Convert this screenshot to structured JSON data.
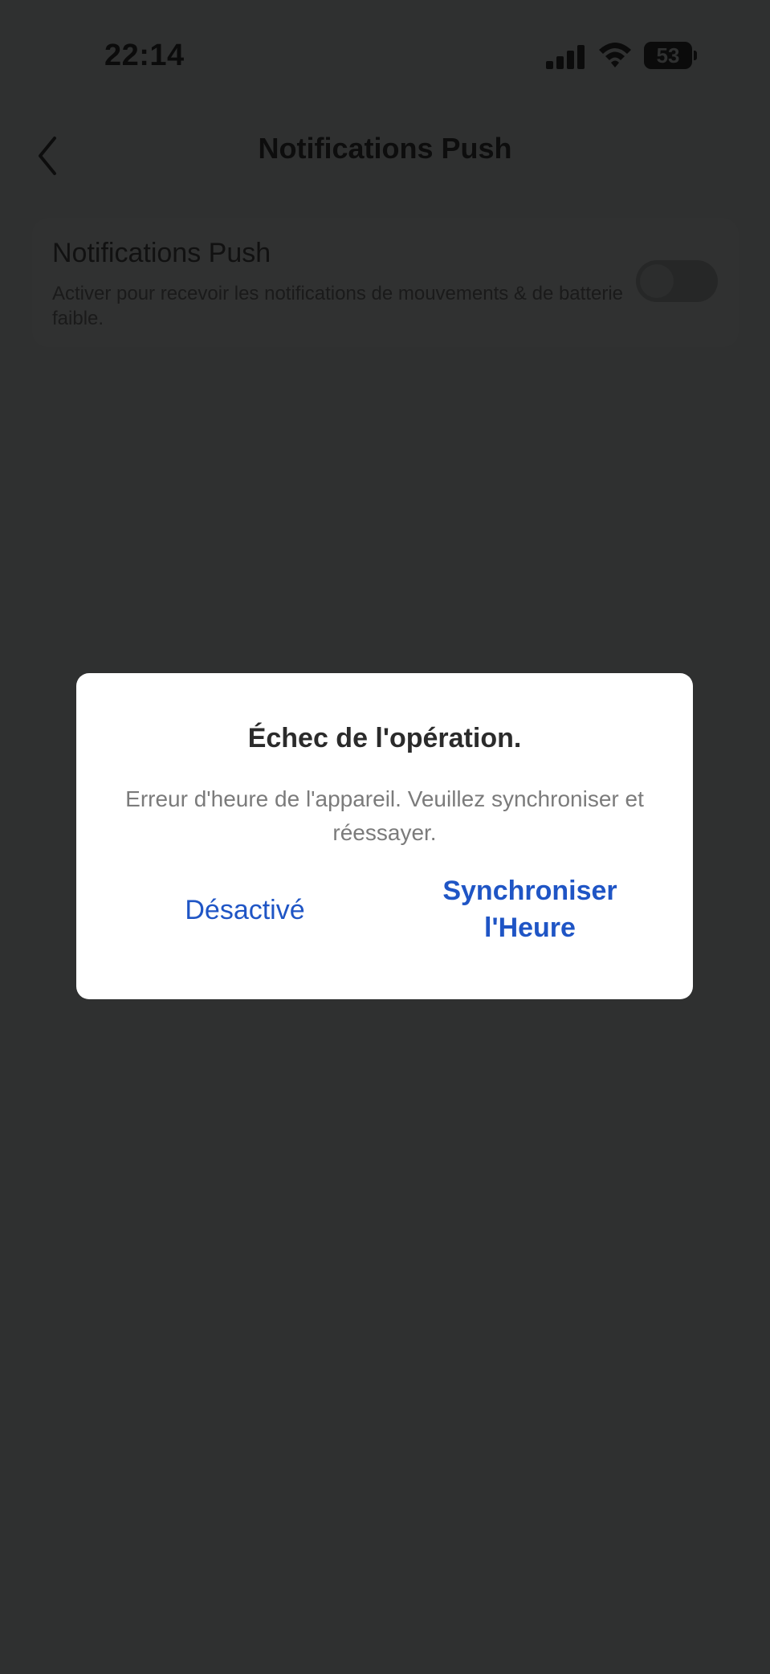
{
  "status_bar": {
    "time": "22:14",
    "battery": "53"
  },
  "header": {
    "title": "Notifications Push"
  },
  "setting": {
    "title": "Notifications Push",
    "description": "Activer pour recevoir les notifications de mouvements & de batterie faible.",
    "enabled": false
  },
  "dialog": {
    "title": "Échec de l'opération.",
    "message": "Erreur d'heure de l'appareil. Veuillez synchroniser et réessayer.",
    "cancel_label": "Désactivé",
    "confirm_label": "Synchroniser l'Heure"
  },
  "colors": {
    "accent": "#1f55c5",
    "overlay": "#2f3030",
    "dialog_bg": "#ffffff"
  }
}
